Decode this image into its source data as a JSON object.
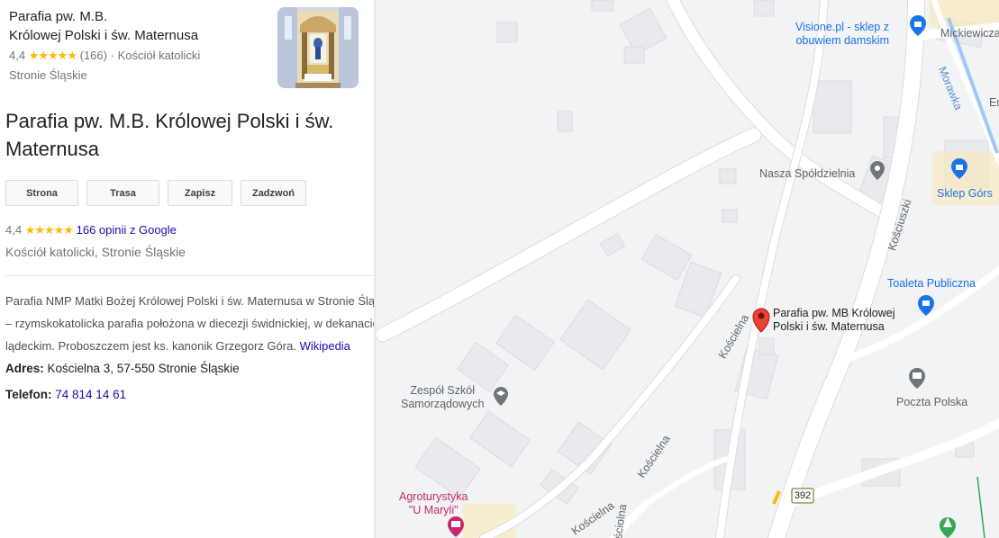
{
  "top_card": {
    "name_line1": "Parafia pw. M.B.",
    "name_line2": "Królowej Polski i św. Maternusa",
    "rating": "4,4",
    "stars": "★★★★★",
    "count": "(166)",
    "separator": "·",
    "category": "Kościół katolicki",
    "location": "Stronie Śląskie"
  },
  "title": "Parafia pw. M.B. Królowej Polski i św. Maternusa",
  "buttons": {
    "website": "Strona",
    "directions": "Trasa",
    "save": "Zapisz",
    "call": "Zadzwoń"
  },
  "rating_line": {
    "rating": "4,4",
    "stars": "★★★★★",
    "reviews_link": "166 opinii z Google"
  },
  "category_line": "Kościół katolicki, Stronie Śląskie",
  "description": {
    "text": "Parafia NMP Matki Bożej Królowej Polski i św. Maternusa w Stronie Śląskim – rzymskokatolicka parafia położona w diecezji świdnickiej, w dekanacie lądeckim. Proboszczem jest ks. kanonik Grzegorz Góra. ",
    "wiki_link": "Wikipedia"
  },
  "address": {
    "label": "Adres:",
    "value": " Kościelna 3, 57-550 Stronie Śląskie"
  },
  "phone": {
    "label": "Telefon:",
    "value": "74 814 14 61"
  },
  "map": {
    "labels": {
      "visione_line1": "Visione.pl - sklep z",
      "visione_line2": "obuwiem damskim",
      "mickiewicza": "Mickiewicza",
      "morawka": "Morawka",
      "er": "Er",
      "nasza": "Nasza Spółdzielnia",
      "sklep": "Sklep Górs",
      "kosciuszki": "Kościuszki",
      "toaleta": "Toaleta Publiczna",
      "parafia_line1": "Parafia pw. MB Królowej",
      "parafia_line2": "Polski i św. Maternusa",
      "koscielna": "Kościelna",
      "zespol_line1": "Zespół Szkół",
      "zespol_line2": "Samorządowych",
      "poczta": "Poczta Polska",
      "agro_line1": "Agroturystyka",
      "agro_line2": "\"U Maryli\"",
      "road_392": "392",
      "kolna": "ściolna"
    },
    "colors": {
      "background": "#f1f3f4",
      "road": "#ffffff",
      "building": "#e8eaed",
      "poi_blue": "#1a73e8",
      "poi_grey": "#70757a",
      "poi_pink": "#c5296b",
      "river": "#9fc6f5",
      "pin_red": "#ea4335"
    }
  }
}
